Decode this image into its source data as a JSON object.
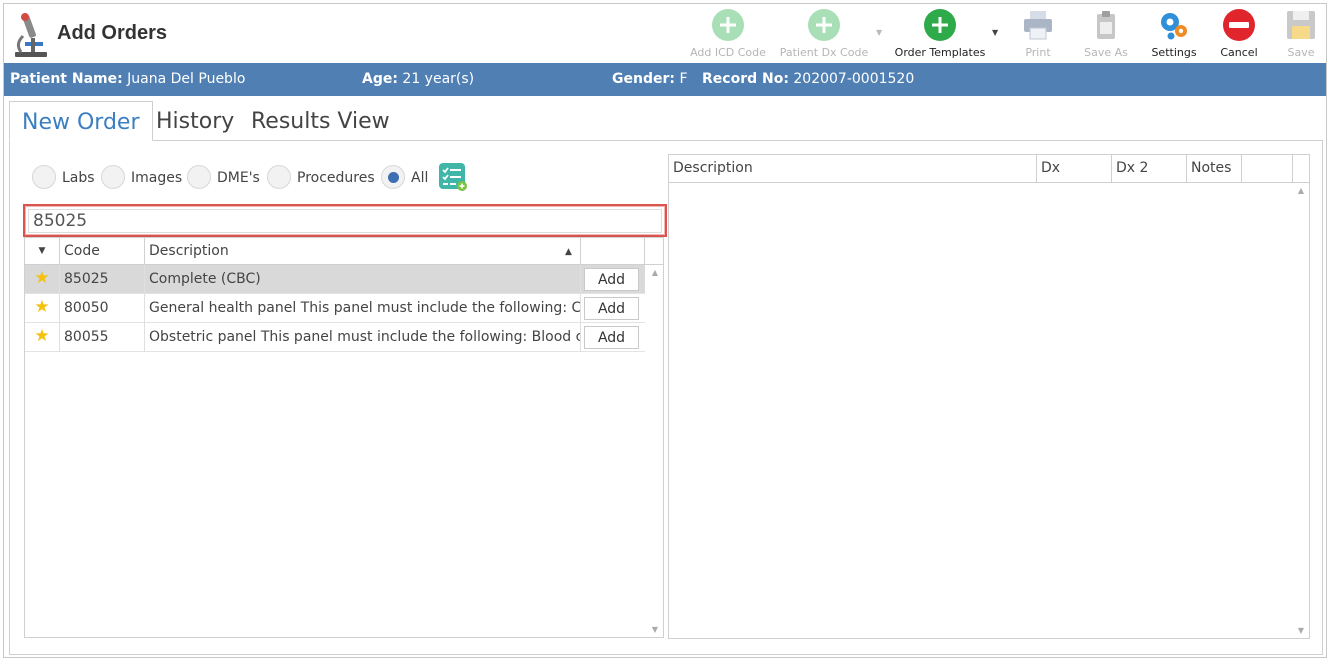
{
  "app": {
    "title": "Add Orders"
  },
  "toolbar": {
    "add_icd": "Add ICD Code",
    "patient_dx": "Patient Dx Code",
    "order_templates": "Order Templates",
    "print": "Print",
    "save_as": "Save As",
    "settings": "Settings",
    "cancel": "Cancel",
    "save": "Save"
  },
  "patient": {
    "name_label": "Patient Name:",
    "name": "Juana Del Pueblo",
    "age_label": "Age:",
    "age": "21 year(s)",
    "gender_label": "Gender:",
    "gender": "F",
    "record_label": "Record No:",
    "record": "202007-0001520"
  },
  "tabs": [
    "New Order",
    "History",
    "Results View"
  ],
  "filters": {
    "options": [
      "Labs",
      "Images",
      "DME's",
      "Procedures",
      "All"
    ],
    "selected": "All"
  },
  "search": {
    "value": "85025"
  },
  "left_grid": {
    "columns": [
      "Code",
      "Description"
    ],
    "rows": [
      {
        "code": "85025",
        "description": "Complete (CBC)",
        "action": "Add"
      },
      {
        "code": "80050",
        "description": "General health panel This panel must include the following: C...",
        "action": "Add"
      },
      {
        "code": "80055",
        "description": "Obstetric panel This panel must include the following: Blood c...",
        "action": "Add"
      }
    ]
  },
  "right_grid": {
    "columns": [
      "Description",
      "Dx",
      "Dx 2",
      "Notes"
    ]
  },
  "colors": {
    "patient_bar": "#4f7fb3",
    "active_tab": "#3b7fc0",
    "search_highlight": "#d9534f",
    "add_green": "#2eaa4a",
    "cancel_red": "#e0262c",
    "star": "#f4c20d"
  },
  "icons": {
    "logo": "microscope-icon",
    "add": "plus-circle-icon",
    "print": "printer-icon",
    "save_as": "clipboard-icon",
    "settings": "gears-icon",
    "cancel": "minus-circle-icon",
    "save": "floppy-disk-icon",
    "checklist": "checklist-icon",
    "favorite": "star-icon"
  }
}
